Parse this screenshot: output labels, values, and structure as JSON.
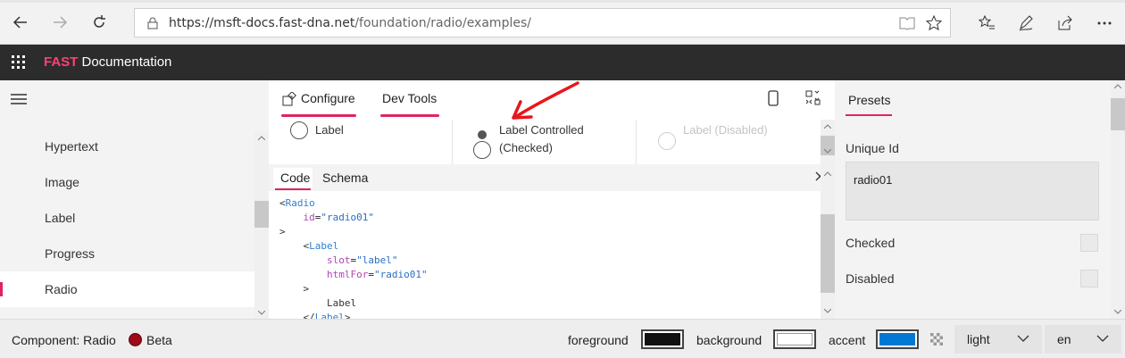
{
  "browser": {
    "url_host": "https://msft-docs.fast-dna.net",
    "url_path": "/foundation/radio/examples/"
  },
  "app": {
    "brand": "FAST",
    "title_rest": " Documentation"
  },
  "sidebar": {
    "items": [
      {
        "label": "Hypertext",
        "active": false
      },
      {
        "label": "Image",
        "active": false
      },
      {
        "label": "Label",
        "active": false
      },
      {
        "label": "Progress",
        "active": false
      },
      {
        "label": "Radio",
        "active": true
      }
    ]
  },
  "center": {
    "tabs": [
      {
        "label": "Configure"
      },
      {
        "label": "Dev Tools"
      }
    ],
    "preview": [
      {
        "label": "Label"
      },
      {
        "label": "Label Controlled",
        "label2": "(Checked)"
      },
      {
        "label": "Label (Disabled)"
      }
    ],
    "code_tabs": [
      {
        "label": "Code"
      },
      {
        "label": "Schema"
      }
    ],
    "code": {
      "l1_open": "<",
      "l1_tag": "Radio",
      "l2_attr": "id",
      "l2_val": "\"radio01\"",
      "l3": ">",
      "l4_open": "<",
      "l4_tag": "Label",
      "l5_attr": "slot",
      "l5_val": "\"label\"",
      "l6_attr": "htmlFor",
      "l6_val": "\"radio01\"",
      "l7": ">",
      "l8": "Label",
      "l9_open": "</",
      "l9_tag": "Label",
      "l9_close": ">"
    }
  },
  "right": {
    "tab": "Presets",
    "unique_id_label": "Unique Id",
    "unique_id_value": "radio01",
    "checked_label": "Checked",
    "disabled_label": "Disabled"
  },
  "footer": {
    "component": "Component: Radio",
    "status": "Beta",
    "status_color": "#9b0c17",
    "foreground_label": "foreground",
    "foreground_color": "#111111",
    "background_label": "background",
    "background_color": "#ffffff",
    "accent_label": "accent",
    "accent_color": "#0078d4",
    "theme_value": "light",
    "locale_value": "en"
  }
}
